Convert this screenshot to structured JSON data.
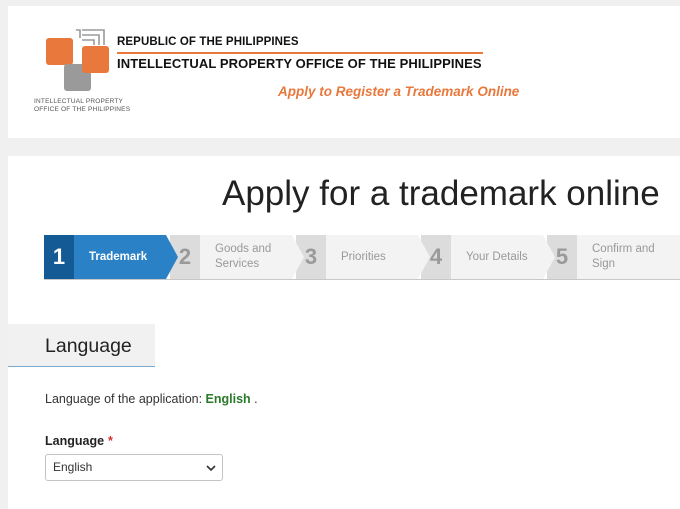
{
  "header": {
    "logo_caption_line1": "INTELLECTUAL PROPERTY",
    "logo_caption_line2": "OFFICE OF THE PHILIPPINES",
    "republic": "REPUBLIC OF THE PHILIPPINES",
    "office": "INTELLECTUAL PROPERTY OFFICE OF THE PHILIPPINES",
    "tagline": "Apply to Register a Trademark Online"
  },
  "colors": {
    "accent_orange": "#e8783c",
    "active_step": "#2b81c5",
    "active_step_number": "#145a94",
    "language_value": "#2a7a2a",
    "required": "#d0312d"
  },
  "main": {
    "title": "Apply for a trademark online",
    "steps": [
      {
        "number": "1",
        "label": "Trademark",
        "active": true
      },
      {
        "number": "2",
        "label": "Goods and\nServices",
        "active": false
      },
      {
        "number": "3",
        "label": "Priorities",
        "active": false
      },
      {
        "number": "4",
        "label": "Your Details",
        "active": false
      },
      {
        "number": "5",
        "label": "Confirm and\nSign",
        "active": false
      }
    ],
    "section_title": "Language",
    "language_line_prefix": "Language of the application: ",
    "language_line_value": "English",
    "language_line_suffix": " .",
    "field_label": "Language",
    "required_mark": "*",
    "select_value": "English",
    "select_icon": "chevron-down-icon"
  }
}
